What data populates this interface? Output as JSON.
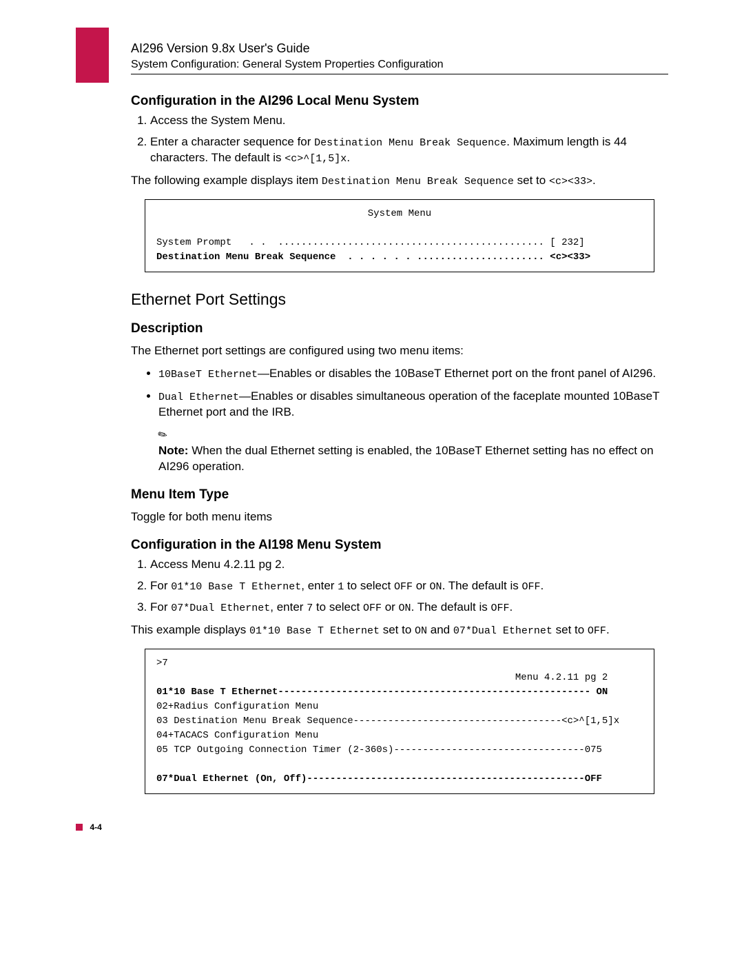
{
  "header": {
    "title": "AI296 Version 9.8x User's Guide",
    "subtitle": "System Configuration: General System Properties Configuration"
  },
  "s1": {
    "heading": "Configuration in the AI296 Local Menu System",
    "step1": "Access the System Menu.",
    "step2_a": "Enter a character sequence for ",
    "step2_code": "Destination Menu Break Sequence",
    "step2_b": ". Maximum length is 44 characters. The default is ",
    "step2_default": "<c>^[1,5]x",
    "step2_c": ".",
    "follow_a": "The following example displays item ",
    "follow_code": "Destination Menu Break Sequence",
    "follow_b": " set to ",
    "follow_val": "<c><33>",
    "follow_c": "."
  },
  "codebox1": {
    "title": "System Menu",
    "line1": "System Prompt   . .  .............................................. [ 232]",
    "line2": "Destination Menu Break Sequence  . . . . . . ...................... <c><33>"
  },
  "s2": {
    "heading": "Ethernet Port Settings"
  },
  "desc": {
    "heading": "Description",
    "intro": "The Ethernet port settings are configured using two menu items:",
    "b1_code": "10BaseT Ethernet",
    "b1_text": "—Enables or disables the 10BaseT Ethernet port on the front panel of AI296.",
    "b2_code": "Dual Ethernet",
    "b2_text": "—Enables or disables simultaneous operation of the faceplate mounted 10BaseT Ethernet port and the IRB.",
    "note_label": "Note:",
    "note_text": "When the dual Ethernet setting is enabled, the 10BaseT Ethernet setting has no effect on AI296 operation."
  },
  "menutype": {
    "heading": "Menu Item Type",
    "text": "Toggle for both menu items"
  },
  "s3": {
    "heading": "Configuration in the AI198 Menu System",
    "step1": "Access Menu 4.2.11 pg 2.",
    "step2_a": "For ",
    "step2_code": "01*10 Base T Ethernet",
    "step2_b": ", enter ",
    "step2_key": "1",
    "step2_c": " to select ",
    "step2_off": "OFF",
    "step2_d": " or ",
    "step2_on": "ON",
    "step2_e": ". The default is ",
    "step2_def": "OFF",
    "step2_f": ".",
    "step3_a": "For ",
    "step3_code": "07*Dual Ethernet",
    "step3_b": ", enter ",
    "step3_key": "7",
    "step3_c": " to select ",
    "step3_off": "OFF",
    "step3_d": " or ",
    "step3_on": "ON",
    "step3_e": ". The default is ",
    "step3_def": "OFF",
    "step3_f": ".",
    "example_a": "This example displays ",
    "example_c1": "01*10 Base T Ethernet",
    "example_b": " set to ",
    "example_v1": "ON",
    "example_c": " and ",
    "example_c2": "07*Dual Ethernet",
    "example_d": " set to ",
    "example_v2": "OFF",
    "example_e": "."
  },
  "codebox2": {
    "l0": ">7",
    "l1": "                                                              Menu 4.2.11 pg 2",
    "l2": "01*10 Base T Ethernet------------------------------------------------------ ON",
    "l3": "02+Radius Configuration Menu",
    "l4": "03 Destination Menu Break Sequence------------------------------------<c>^[1,5]x",
    "l5": "04+TACACS Configuration Menu",
    "l6": "05 TCP Outgoing Connection Timer (2-360s)---------------------------------075",
    "l7": "",
    "l8": "07*Dual Ethernet (On, Off)------------------------------------------------OFF"
  },
  "footer": {
    "page": "4-4"
  }
}
